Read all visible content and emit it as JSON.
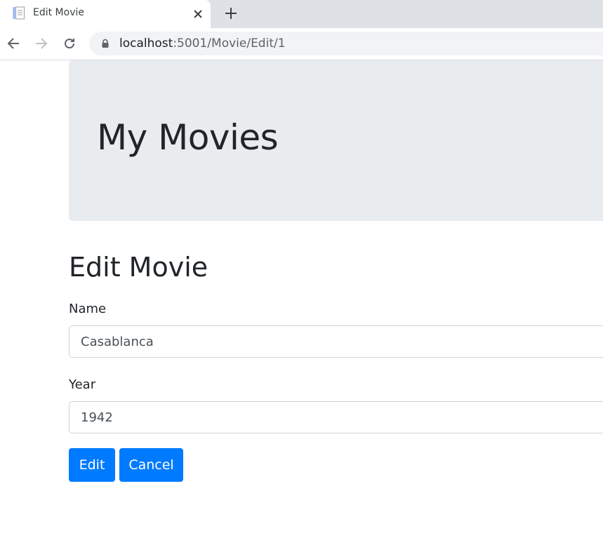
{
  "browser": {
    "tab": {
      "title": "Edit Movie"
    },
    "address": {
      "host": "localhost",
      "path": ":5001/Movie/Edit/1"
    }
  },
  "page": {
    "jumbotron_title": "My Movies",
    "heading": "Edit Movie",
    "form": {
      "name_label": "Name",
      "name_value": "Casablanca",
      "year_label": "Year",
      "year_value": "1942",
      "edit_button": "Edit",
      "cancel_button": "Cancel"
    }
  },
  "colors": {
    "primary": "#007bff",
    "jumbotron_bg": "#e9ecef",
    "tabstrip_bg": "#dee1e6"
  },
  "icons": [
    "document-icon",
    "close-icon",
    "plus-icon",
    "back-arrow-icon",
    "forward-arrow-icon",
    "reload-icon",
    "lock-icon"
  ]
}
